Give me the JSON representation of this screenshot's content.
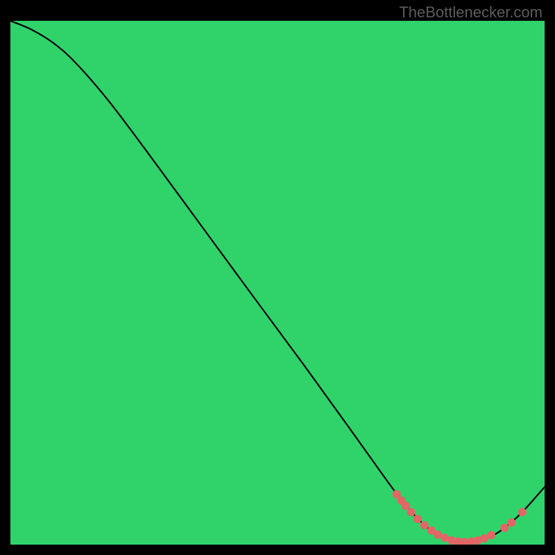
{
  "watermark": "TheBottlenecker.com",
  "chart_data": {
    "type": "line",
    "title": "",
    "xlabel": "",
    "ylabel": "",
    "xlim": [
      0,
      100
    ],
    "ylim": [
      0,
      100
    ],
    "curve": [
      {
        "x": 0.0,
        "y": 100.0
      },
      {
        "x": 4.0,
        "y": 98.3
      },
      {
        "x": 8.0,
        "y": 95.8
      },
      {
        "x": 12.0,
        "y": 92.2
      },
      {
        "x": 18.0,
        "y": 85.2
      },
      {
        "x": 25.0,
        "y": 75.8
      },
      {
        "x": 35.0,
        "y": 61.9
      },
      {
        "x": 45.0,
        "y": 48.0
      },
      {
        "x": 55.0,
        "y": 34.2
      },
      {
        "x": 63.0,
        "y": 22.9
      },
      {
        "x": 70.0,
        "y": 12.9
      },
      {
        "x": 74.0,
        "y": 7.5
      },
      {
        "x": 78.0,
        "y": 3.3
      },
      {
        "x": 82.0,
        "y": 1.0
      },
      {
        "x": 86.0,
        "y": 0.5
      },
      {
        "x": 90.0,
        "y": 1.6
      },
      {
        "x": 93.0,
        "y": 3.6
      },
      {
        "x": 96.0,
        "y": 6.4
      },
      {
        "x": 100.0,
        "y": 11.0
      }
    ],
    "curve_style": {
      "stroke": "#000000",
      "stroke_width": 2.2
    },
    "markers": [
      {
        "x": 72.3,
        "y": 9.6
      },
      {
        "x": 73.2,
        "y": 8.4
      },
      {
        "x": 74.0,
        "y": 7.4
      },
      {
        "x": 75.0,
        "y": 6.2
      },
      {
        "x": 76.2,
        "y": 4.9
      },
      {
        "x": 77.5,
        "y": 3.7
      },
      {
        "x": 78.8,
        "y": 2.7
      },
      {
        "x": 80.0,
        "y": 1.9
      },
      {
        "x": 81.3,
        "y": 1.3
      },
      {
        "x": 82.6,
        "y": 0.8
      },
      {
        "x": 83.8,
        "y": 0.6
      },
      {
        "x": 85.0,
        "y": 0.5
      },
      {
        "x": 86.3,
        "y": 0.6
      },
      {
        "x": 87.5,
        "y": 0.8
      },
      {
        "x": 88.7,
        "y": 1.2
      },
      {
        "x": 90.0,
        "y": 1.8
      },
      {
        "x": 92.5,
        "y": 3.2
      },
      {
        "x": 93.8,
        "y": 4.2
      },
      {
        "x": 95.8,
        "y": 6.2
      }
    ],
    "marker_style": {
      "fill": "#e36666",
      "radius": 6
    },
    "background_gradient": {
      "bottom_band_end": 0.02,
      "stops": [
        {
          "offset": 0.0,
          "color": "#2fd36a"
        },
        {
          "offset": 0.02,
          "color": "#d5f85c"
        },
        {
          "offset": 0.035,
          "color": "#efff79"
        },
        {
          "offset": 0.11,
          "color": "#fafb8d"
        },
        {
          "offset": 0.3,
          "color": "#ffde43"
        },
        {
          "offset": 0.5,
          "color": "#fea83c"
        },
        {
          "offset": 0.7,
          "color": "#fd7341"
        },
        {
          "offset": 0.87,
          "color": "#fc4349"
        },
        {
          "offset": 1.0,
          "color": "#fb2c4d"
        }
      ]
    }
  }
}
